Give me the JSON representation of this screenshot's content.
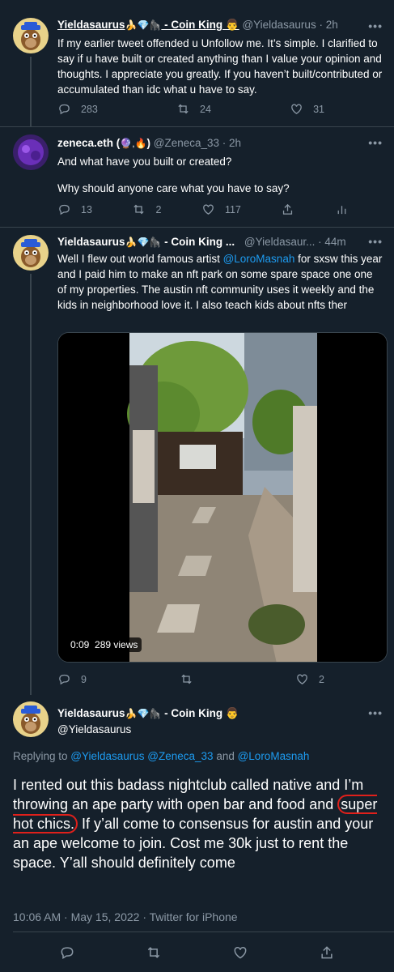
{
  "tweets": [
    {
      "name": "Yieldasaurus",
      "badges": "🍌💎🦍",
      "suffix": " - Coin King 👨",
      "handle": "@Yieldasaurus",
      "time": "· 2h",
      "text": "If my earlier tweet offended u Unfollow me. It’s simple. I clarified to say if u have built or created anything than I value your opinion and thoughts. I appreciate you greatly. If you haven’t built/contributed or accumulated than idc what u have to say.",
      "replies": "283",
      "retweets": "24",
      "likes": "31"
    },
    {
      "name": "zeneca.eth (",
      "badges": "🔮,🔥",
      "suffix": ")",
      "handle": "@Zeneca_33",
      "time": "· 2h",
      "text1": "And what have you built or created?",
      "text2": "Why should anyone care what you have to say?",
      "replies": "13",
      "retweets": "2",
      "likes": "117"
    },
    {
      "name": "Yieldasaurus",
      "badges": "🍌💎🦍",
      "suffix": " - Coin King ...",
      "handle": "@Yieldasaur...",
      "time": "· 44m",
      "text_before": "Well I flew out world famous artist ",
      "mention": "@LoroMasnah",
      "text_after": " for sxsw this year and I paid him to make an nft park on some spare space one one of my properties. The austin nft community uses it weekly and the kids in neighborhood love it. I also teach kids about nfts ther",
      "video_time": "0:09",
      "video_views": "289 views",
      "replies": "9",
      "retweets": "",
      "likes": "2"
    }
  ],
  "main_tweet": {
    "name": "Yieldasaurus",
    "badges": "🍌💎🦍",
    "suffix": " - Coin King 👨",
    "handle": "@Yieldasaurus",
    "replying_prefix": "Replying to ",
    "replying_to": "@Yieldasaurus @Zeneca_33",
    "replying_and": " and ",
    "replying_last": "@LoroMasnah",
    "text_a": "I rented out this badass nightclub called native and I’m throwing an ape party with open bar and food and ",
    "text_circled": "super hot chics.",
    "text_b": " If y’all come to consensus for austin and your an ape welcome to join. Cost me 30k just to rent the space. Y’all should definitely come",
    "meta": "10:06 AM · May 15, 2022 · Twitter for iPhone"
  },
  "more_icon": "•••",
  "colors": {
    "bg": "#15202b",
    "text": "#ffffff",
    "muted": "#8b98a5",
    "link": "#1d9bf0",
    "border": "#38444d",
    "circle": "#e0201b"
  }
}
